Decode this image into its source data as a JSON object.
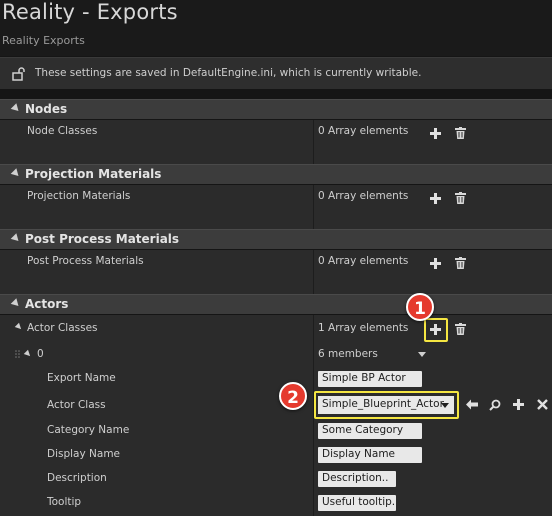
{
  "window": {
    "title": "Reality - Exports",
    "subtitle": "Reality Exports"
  },
  "notice": {
    "text": "These settings are saved in DefaultEngine.ini, which is currently writable.",
    "icon": "unlocked-lock-icon"
  },
  "categories": {
    "nodes": {
      "label": "Nodes",
      "property": "Node Classes",
      "value": "0 Array elements"
    },
    "projection": {
      "label": "Projection Materials",
      "property": "Projection Materials",
      "value": "0 Array elements"
    },
    "postprocess": {
      "label": "Post Process Materials",
      "property": "Post Process Materials",
      "value": "0 Array elements"
    },
    "actors": {
      "label": "Actors",
      "property": "Actor Classes",
      "value": "1 Array elements",
      "element": {
        "index": "0",
        "members": "6 members",
        "export_name_label": "Export Name",
        "export_name_value": "Simple BP Actor",
        "actor_class_label": "Actor Class",
        "actor_class_value": "Simple_Blueprint_Actor",
        "category_name_label": "Category Name",
        "category_name_value": "Some Category",
        "display_name_label": "Display Name",
        "display_name_value": "Display Name",
        "description_label": "Description",
        "description_value": "Description..",
        "tooltip_label": "Tooltip",
        "tooltip_value": "Useful tooltip."
      }
    }
  },
  "annotations": {
    "badge_1": "1",
    "badge_2": "2"
  },
  "colors": {
    "highlight": "#f5e642",
    "badge": "#e53a2e"
  }
}
